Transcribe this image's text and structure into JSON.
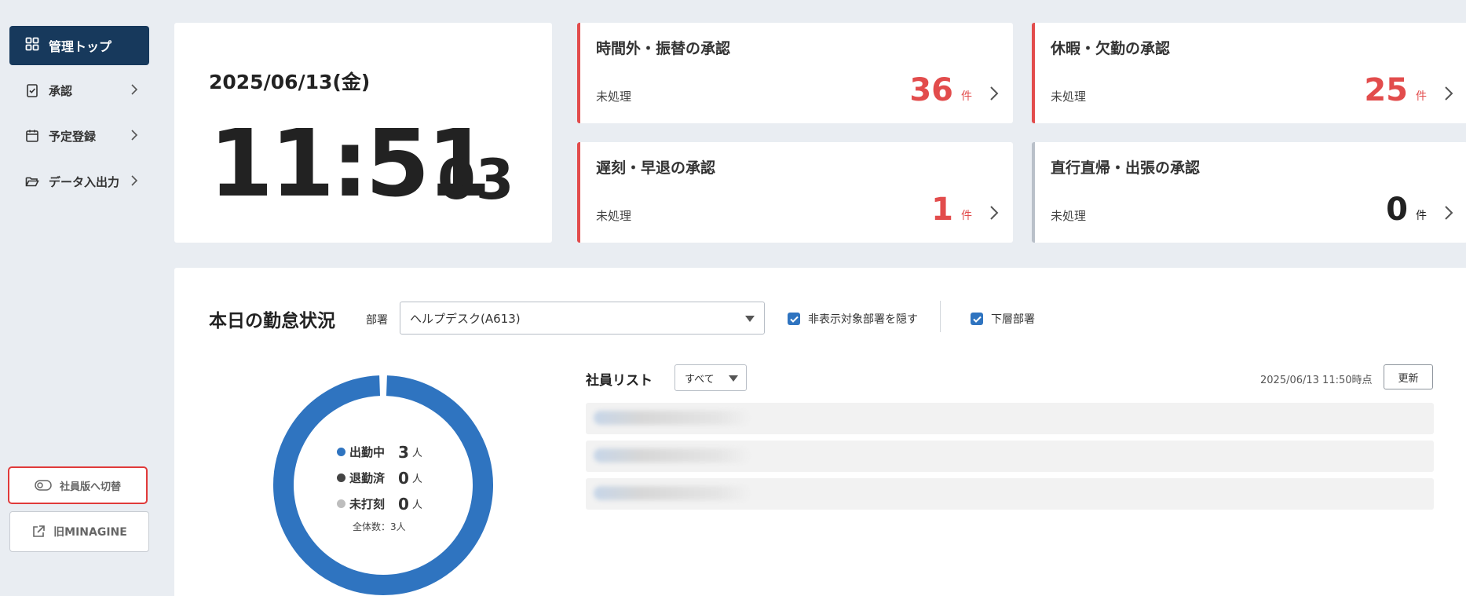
{
  "sidebar": {
    "active_item": {
      "label": "管理トップ",
      "icon": "grid-icon"
    },
    "items": [
      {
        "label": "承認",
        "icon": "clipboard-check-icon"
      },
      {
        "label": "予定登録",
        "icon": "calendar-icon"
      },
      {
        "label": "データ入出力",
        "icon": "folder-open-icon"
      }
    ],
    "switch_button": {
      "label": "社員版へ切替",
      "icon": "toggle-icon"
    },
    "old_button": {
      "label": "旧MINAGINE",
      "icon": "external-link-icon"
    }
  },
  "clock": {
    "date": "2025/06/13(金)",
    "time": "11:51",
    "seconds": "03"
  },
  "approvals": [
    {
      "title": "時間外・振替の承認",
      "sub": "未処理",
      "count": "36",
      "unit": "件",
      "accent": "#e24c4c"
    },
    {
      "title": "休暇・欠勤の承認",
      "sub": "未処理",
      "count": "25",
      "unit": "件",
      "accent": "#e24c4c"
    },
    {
      "title": "遅刻・早退の承認",
      "sub": "未処理",
      "count": "1",
      "unit": "件",
      "accent": "#e24c4c"
    },
    {
      "title": "直行直帰・出張の承認",
      "sub": "未処理",
      "count": "0",
      "unit": "件",
      "accent": "#b9c0c9"
    }
  ],
  "status": {
    "title": "本日の勤怠状況",
    "dept_label": "部署",
    "dept_value": "ヘルプデスク(A613)",
    "hide_checkbox_label": "非表示対象部署を隠す",
    "sub_dept_checkbox_label": "下層部署",
    "legend": [
      {
        "label": "出勤中",
        "count": "3",
        "unit": "人",
        "color": "#2f74c0"
      },
      {
        "label": "退勤済",
        "count": "0",
        "unit": "人",
        "color": "#444444"
      },
      {
        "label": "未打刻",
        "count": "0",
        "unit": "人",
        "color": "#bdbdbd"
      }
    ],
    "total": "全体数：3人",
    "list_title": "社員リスト",
    "filter_value": "すべて",
    "as_of": "2025/06/13 11:50時点",
    "refresh_label": "更新"
  },
  "chart_data": {
    "type": "pie",
    "categories": [
      "出勤中",
      "退勤済",
      "未打刻"
    ],
    "values": [
      3,
      0,
      0
    ],
    "colors": [
      "#2f74c0",
      "#444444",
      "#bdbdbd"
    ]
  },
  "colors": {
    "sidebar_active": "#17395c",
    "alert": "#e24c4c",
    "primary": "#2f74c0"
  }
}
